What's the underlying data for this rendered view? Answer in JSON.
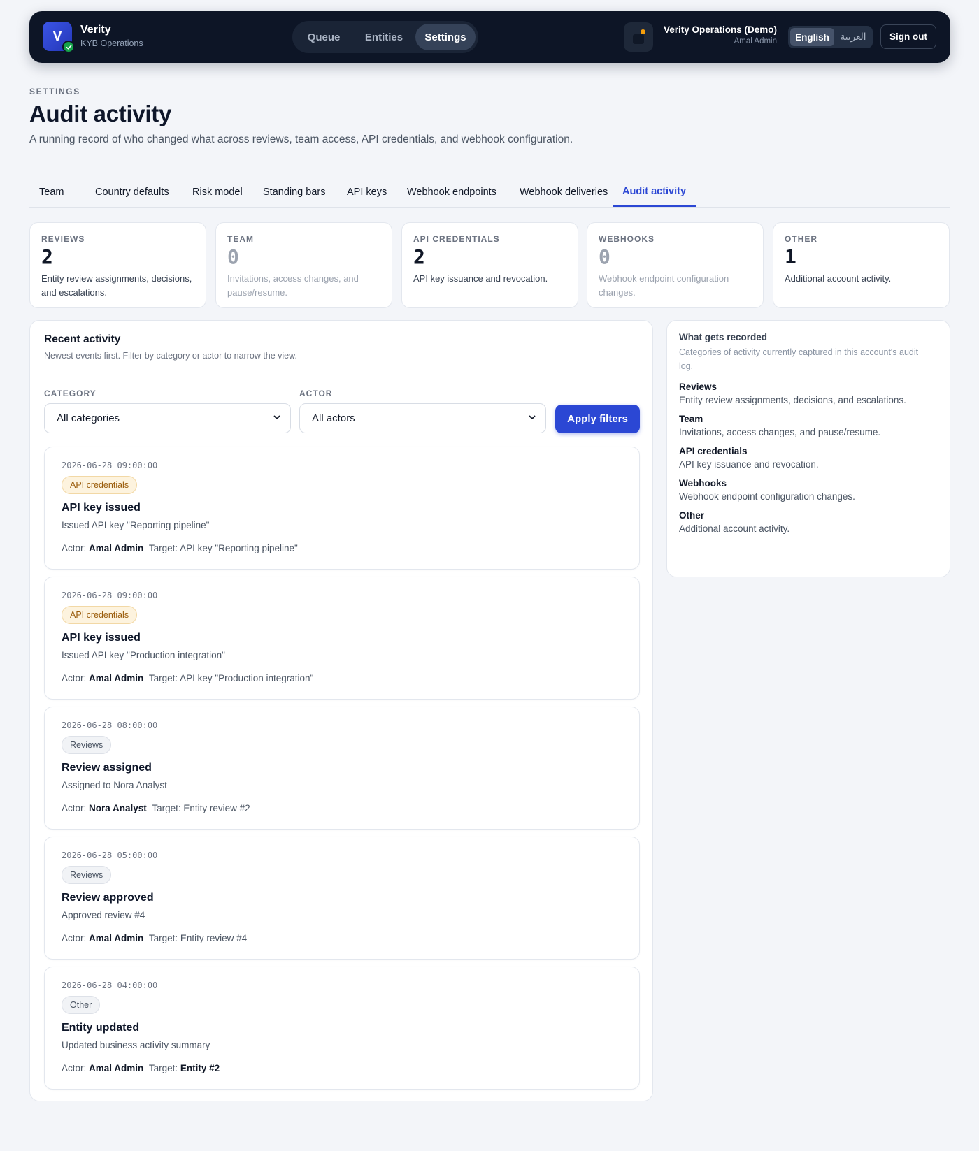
{
  "brand": {
    "logo_letter": "V",
    "name": "Verity",
    "subtitle": "KYB Operations"
  },
  "nav": [
    {
      "label": "Queue",
      "active": false
    },
    {
      "label": "Entities",
      "active": false
    },
    {
      "label": "Settings",
      "active": true
    }
  ],
  "account": {
    "org": "Verity Operations (Demo)",
    "user": "Amal Admin"
  },
  "language": {
    "options": [
      "English",
      "العربية"
    ],
    "selected": "English"
  },
  "signout_label": "Sign out",
  "header": {
    "eyebrow": "SETTINGS",
    "title": "Audit activity",
    "description": "A running record of who changed what across reviews, team access, API credentials, and webhook configuration."
  },
  "tabs": [
    {
      "label": "Team",
      "active": false
    },
    {
      "label": "Country defaults",
      "active": false
    },
    {
      "label": "Risk model",
      "active": false
    },
    {
      "label": "Standing bars",
      "active": false
    },
    {
      "label": "API keys",
      "active": false
    },
    {
      "label": "Webhook endpoints",
      "active": false
    },
    {
      "label": "Webhook deliveries",
      "active": false
    },
    {
      "label": "Audit activity",
      "active": true
    }
  ],
  "stats": [
    {
      "label": "REVIEWS",
      "count": "2",
      "text": "Entity review assignments, decisions, and escalations."
    },
    {
      "label": "TEAM",
      "count": "0",
      "text": "Invitations, access changes, and pause/resume."
    },
    {
      "label": "API CREDENTIALS",
      "count": "2",
      "text": "API key issuance and revocation."
    },
    {
      "label": "WEBHOOKS",
      "count": "0",
      "text": "Webhook endpoint configuration changes."
    },
    {
      "label": "OTHER",
      "count": "1",
      "text": "Additional account activity."
    }
  ],
  "activity": {
    "title": "Recent activity",
    "subtitle": "Newest events first. Filter by category or actor to narrow the view.",
    "filters": {
      "category_label": "CATEGORY",
      "category_value": "All categories",
      "actor_label": "ACTOR",
      "actor_value": "All actors",
      "apply_label": "Apply filters"
    },
    "actor_prefix": "Actor:",
    "target_prefix": "Target:",
    "events": [
      {
        "time": "2026-06-28 09:00:00",
        "category": "API credentials",
        "title": "API key issued",
        "description": "Issued API key \"Reporting pipeline\"",
        "actor": "Amal Admin",
        "target": "API key \"Reporting pipeline\""
      },
      {
        "time": "2026-06-28 09:00:00",
        "category": "API credentials",
        "title": "API key issued",
        "description": "Issued API key \"Production integration\"",
        "actor": "Amal Admin",
        "target": "API key \"Production integration\""
      },
      {
        "time": "2026-06-28 08:00:00",
        "category": "Reviews",
        "title": "Review assigned",
        "description": "Assigned to Nora Analyst",
        "actor": "Nora Analyst",
        "target": "Entity review #2"
      },
      {
        "time": "2026-06-28 05:00:00",
        "category": "Reviews",
        "title": "Review approved",
        "description": "Approved review #4",
        "actor": "Amal Admin",
        "target": "Entity review #4"
      },
      {
        "time": "2026-06-28 04:00:00",
        "category": "Other",
        "title": "Entity updated",
        "description": "Updated business activity summary",
        "actor": "Amal Admin",
        "target": "Entity #2"
      }
    ]
  },
  "recorded": {
    "title": "What gets recorded",
    "subtitle": "Categories of activity currently captured in this account's audit log.",
    "items": [
      {
        "name": "Reviews",
        "text": "Entity review assignments, decisions, and escalations."
      },
      {
        "name": "Team",
        "text": "Invitations, access changes, and pause/resume."
      },
      {
        "name": "API credentials",
        "text": "API key issuance and revocation."
      },
      {
        "name": "Webhooks",
        "text": "Webhook endpoint configuration changes."
      },
      {
        "name": "Other",
        "text": "Additional account activity."
      }
    ]
  },
  "colors": {
    "accent": "#2b47d4",
    "nav_bg": "#0d1526",
    "success": "#16a34a",
    "warning_badge": "#fdf3de"
  }
}
